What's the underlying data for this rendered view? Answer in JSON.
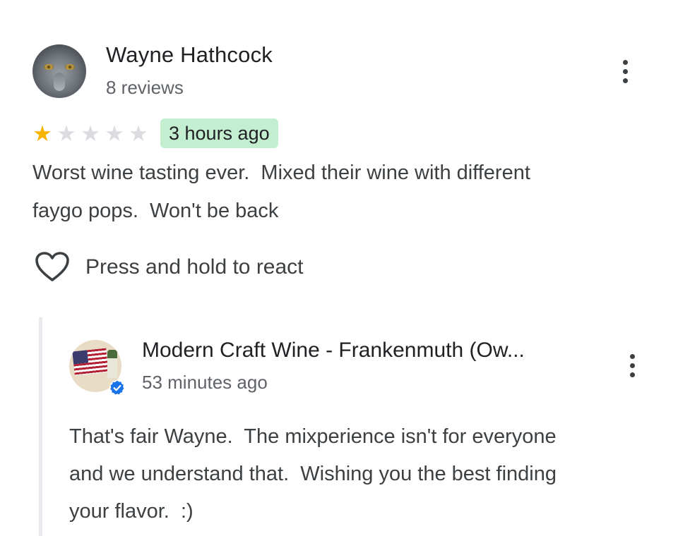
{
  "review": {
    "reviewer_name": "Wayne Hathcock",
    "reviewer_review_count": "8 reviews",
    "rating": 1,
    "rating_max": 5,
    "time_ago": "3 hours ago",
    "text": "Worst wine tasting ever.  Mixed their wine with different\nfaygo pops.  Won't be back",
    "react_label": "Press and hold to react",
    "more_icon": "more-vert-icon",
    "react_icon": "heart-outline-icon",
    "badge_color": "#c4eed0",
    "star_color": "#f6b400"
  },
  "owner_reply": {
    "owner_name": "Modern Craft Wine - Frankenmuth (Ow...",
    "time_ago": "53 minutes ago",
    "text": "That's fair Wayne.  The mixperience isn't for everyone\nand we understand that.  Wishing you the best finding\nyour flavor.  :)",
    "verified_icon": "verified-badge-icon",
    "more_icon": "more-vert-icon",
    "verified_color": "#1a73e8"
  }
}
